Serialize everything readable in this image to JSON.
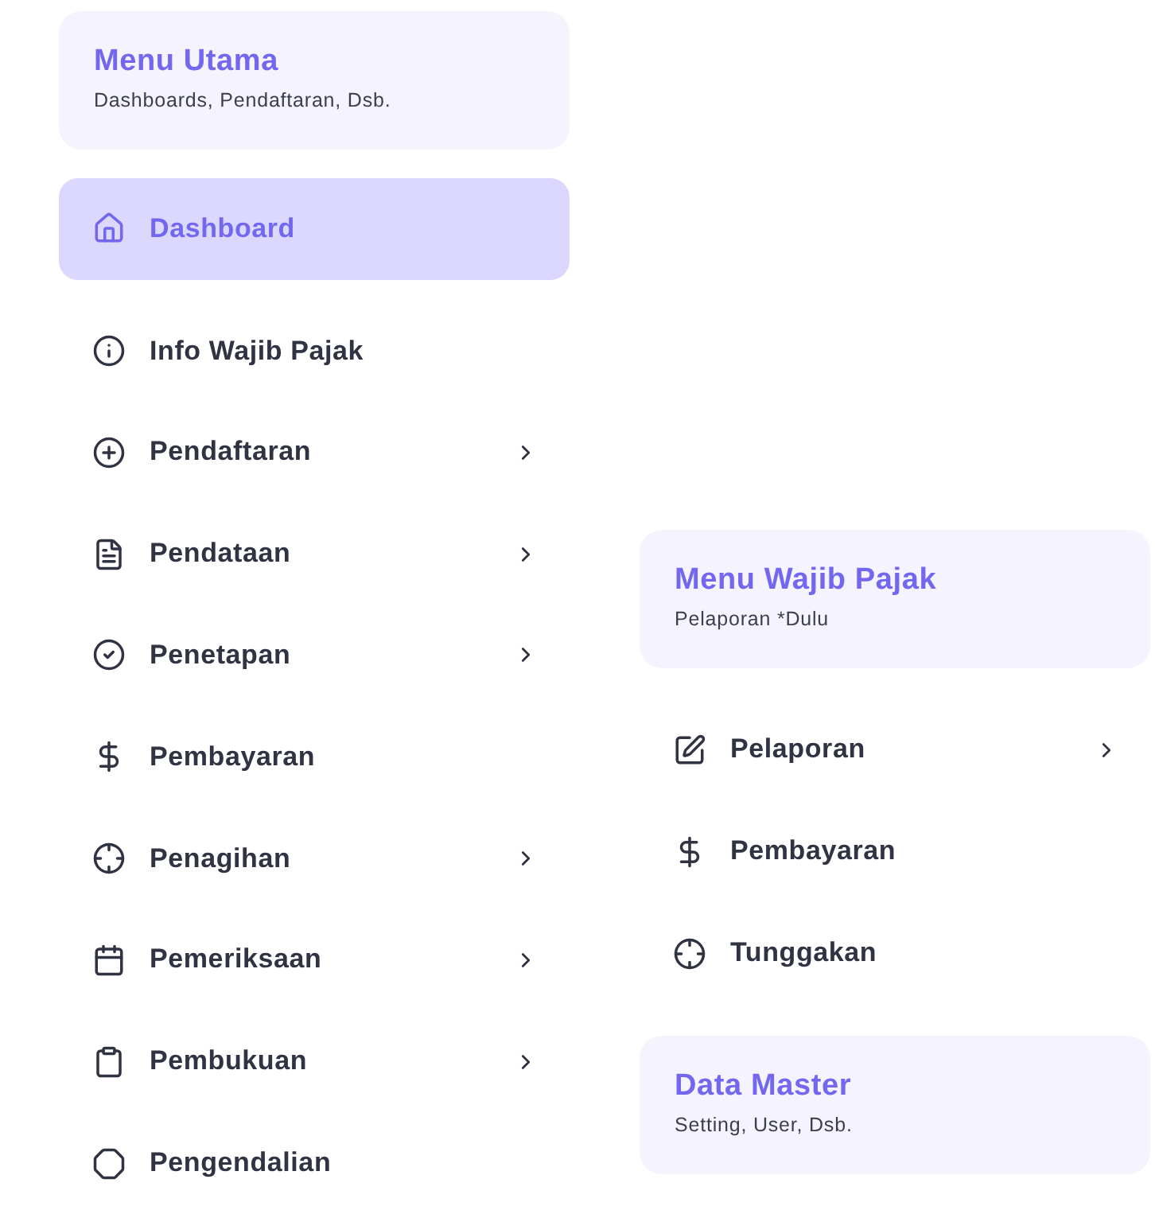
{
  "main_menu": {
    "header": {
      "title": "Menu Utama",
      "subtitle": "Dashboards, Pendaftaran, Dsb."
    },
    "items": [
      {
        "label": "Dashboard",
        "selected": true,
        "has_submenu": false
      },
      {
        "label": "Info Wajib Pajak",
        "selected": false,
        "has_submenu": false
      },
      {
        "label": "Pendaftaran",
        "selected": false,
        "has_submenu": true
      },
      {
        "label": "Pendataan",
        "selected": false,
        "has_submenu": true
      },
      {
        "label": "Penetapan",
        "selected": false,
        "has_submenu": true
      },
      {
        "label": "Pembayaran",
        "selected": false,
        "has_submenu": false
      },
      {
        "label": "Penagihan",
        "selected": false,
        "has_submenu": true
      },
      {
        "label": "Pemeriksaan",
        "selected": false,
        "has_submenu": true
      },
      {
        "label": "Pembukuan",
        "selected": false,
        "has_submenu": true
      },
      {
        "label": "Pengendalian",
        "selected": false,
        "has_submenu": false
      }
    ]
  },
  "taxpayer_menu": {
    "header": {
      "title": "Menu Wajib Pajak",
      "subtitle": "Pelaporan *Dulu"
    },
    "items": [
      {
        "label": "Pelaporan",
        "selected": false,
        "has_submenu": true
      },
      {
        "label": "Pembayaran",
        "selected": false,
        "has_submenu": false
      },
      {
        "label": "Tunggakan",
        "selected": false,
        "has_submenu": false
      }
    ]
  },
  "data_master": {
    "title": "Data Master",
    "subtitle": "Setting, User, Dsb."
  }
}
